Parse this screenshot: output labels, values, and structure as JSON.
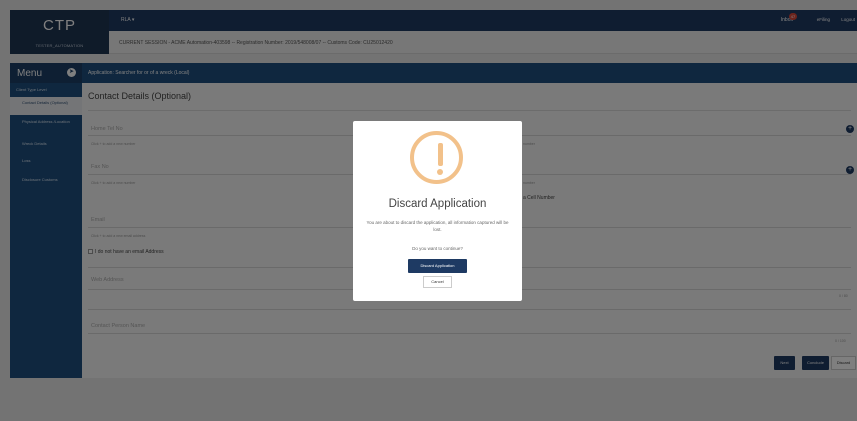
{
  "header": {
    "logo": "CTP",
    "environment": "TESTER_AUTOMATION",
    "menu_label": "RLA ▾",
    "inbox_label": "Inbox",
    "inbox_count": "47",
    "billing_label": "eFiling",
    "logout_label": "Logout"
  },
  "session_text": "CURRENT SESSION - ACME Automation-403598 -- Registration Number: 2019/548008/07 -- Customs Code: CU25012420",
  "sidebar": {
    "title": "Menu",
    "items": [
      {
        "label": "Client Type Level",
        "active": false
      },
      {
        "label": "Contact Details (Optional)",
        "active": true
      },
      {
        "label": "Physical Address /Location",
        "active": false
      },
      {
        "label": "Wreck Details",
        "active": false
      },
      {
        "label": "Loss",
        "active": false
      },
      {
        "label": "Disclosure Customs",
        "active": false
      }
    ]
  },
  "app_title": "Application: Searcher for or of a wreck (Local)",
  "form": {
    "section_title": "Contact Details (Optional)",
    "home_tel_label": "Home Tel No",
    "home_tel_hint": "Click + to add a new number",
    "fax_label": "Fax No",
    "fax_hint": "Click + to add a new number",
    "right_hint_1": "number",
    "right_hint_2": "number",
    "no_cell_label": "a Cell Number",
    "email_label": "Email",
    "email_hint": "Click + to add a new email address",
    "no_email_label": "I do not have an email Address",
    "web_label": "Web Address",
    "web_count": "0 / 80",
    "contact_person_label": "Contact Person Name",
    "contact_person_count": "0 / 100"
  },
  "actions": {
    "next": "Next",
    "conclude": "Conclude",
    "discard": "Discard"
  },
  "modal": {
    "title": "Discard Application",
    "message": "You are about to discard the application, all information captured will be lost.",
    "question": "Do you want to continue?",
    "confirm_label": "Discard Application",
    "cancel_label": "Cancel"
  },
  "colors": {
    "navy": "#1e3a63",
    "sidebar_blue": "#1e4f7f",
    "warning": "#f2c18a",
    "badge": "#d9483b"
  }
}
